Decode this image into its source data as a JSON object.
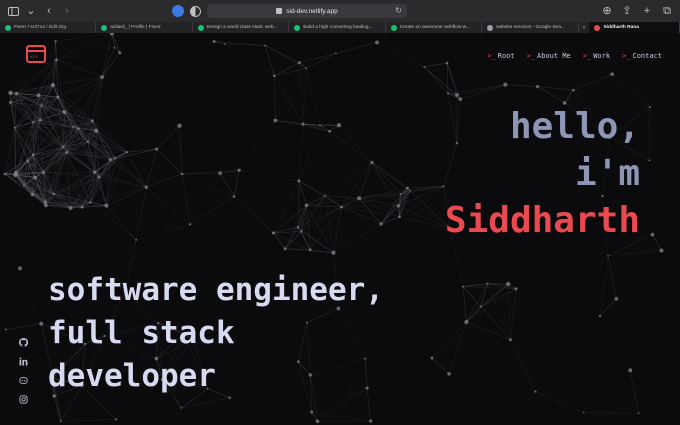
{
  "browser": {
    "url": "sid-dev.netlify.app",
    "tabs": [
      {
        "label": "Fiverr / sr4714 / Edit Gig",
        "color": "#1dbf73",
        "width": 98,
        "active": false
      },
      {
        "label": "azilard_ | Profile | Fiverr",
        "color": "#1dbf73",
        "width": 98,
        "active": false
      },
      {
        "label": "Design a world class static web...",
        "color": "#1dbf73",
        "width": 98,
        "active": false
      },
      {
        "label": "Build a high converting landing...",
        "color": "#1dbf73",
        "width": 98,
        "active": false
      },
      {
        "label": "Create an awesome webflow w...",
        "color": "#1dbf73",
        "width": 98,
        "active": false
      },
      {
        "label": "website services - Google Sea...",
        "color": "#9aa0a6",
        "width": 98,
        "active": false
      },
      {
        "label": "Siddharth Rana",
        "color": "#e84a4f",
        "width": 92,
        "active": true
      }
    ]
  },
  "nav": {
    "prompt": ">_",
    "items": [
      {
        "label": "Root",
        "name": "nav-root"
      },
      {
        "label": "About Me",
        "name": "nav-about-me"
      },
      {
        "label": "Work",
        "name": "nav-work"
      },
      {
        "label": "Contact",
        "name": "nav-contact"
      }
    ]
  },
  "hero": {
    "line1": "hello,",
    "line2": "i'm",
    "name": "Siddharth",
    "tagline": [
      "software engineer,",
      "full stack",
      "developer"
    ]
  },
  "socials": [
    {
      "icon": "github-icon"
    },
    {
      "icon": "linkedin-icon"
    },
    {
      "icon": "discord-icon"
    },
    {
      "icon": "instagram-icon"
    }
  ],
  "colors": {
    "accent": "#e84a4f",
    "greeting": "#8d96b4",
    "tagline": "#d8daf2",
    "background": "#0b0b0d"
  }
}
